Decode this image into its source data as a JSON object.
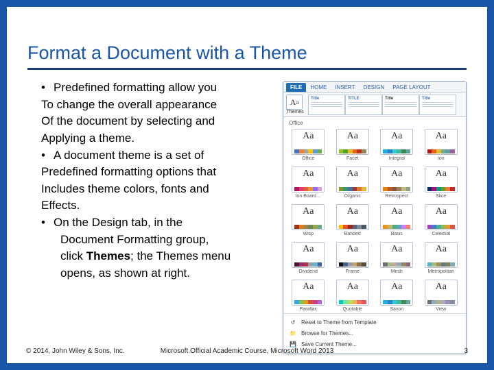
{
  "title": "Format a Document with a Theme",
  "bullets": {
    "l0": "Predefined formatting allow you",
    "l1": "To change the overall appearance",
    "l2": "Of the document by selecting and",
    "l3": "Applying a theme.",
    "l4": "A document theme is a set of",
    "l5": "Predefined formatting options that",
    "l6": "Includes theme colors, fonts and",
    "l7": "Effects.",
    "l8": "On the Design tab, in the",
    "l9": "Document Formatting group,",
    "l10a": "click ",
    "l10b": "Themes",
    "l10c": "; the Themes menu",
    "l11": "opens, as shown at right."
  },
  "ribbon": {
    "tabs": [
      "FILE",
      "HOME",
      "INSERT",
      "DESIGN",
      "PAGE LAYOUT"
    ],
    "themes_label": "Themes",
    "preview_title": "Title",
    "preview_title2": "TITLE",
    "preview_title3": "Title"
  },
  "sections": {
    "office": "Office"
  },
  "themes": [
    {
      "name": "Office",
      "colors": [
        "#4472c4",
        "#ed7d31",
        "#a5a5a5",
        "#ffc000",
        "#5b9bd5",
        "#70ad47"
      ]
    },
    {
      "name": "Facet",
      "colors": [
        "#90c226",
        "#54a021",
        "#e6b91e",
        "#e76618",
        "#c42f1a",
        "#918655"
      ]
    },
    {
      "name": "Integral",
      "colors": [
        "#1cade4",
        "#2683c6",
        "#27ced7",
        "#42ba97",
        "#3e8853",
        "#62a39f"
      ]
    },
    {
      "name": "Ion",
      "colors": [
        "#b01513",
        "#ea6312",
        "#e6b729",
        "#6aac90",
        "#5f9c9d",
        "#9e5e9b"
      ]
    },
    {
      "name": "Ion Board…",
      "colors": [
        "#b31166",
        "#e33d6f",
        "#e45f3c",
        "#e9943a",
        "#9b6bf2",
        "#d5a4cf"
      ]
    },
    {
      "name": "Organic",
      "colors": [
        "#83992a",
        "#3c9770",
        "#44709d",
        "#a23c33",
        "#d97828",
        "#deb340"
      ]
    },
    {
      "name": "Retrospect",
      "colors": [
        "#e48312",
        "#bd582c",
        "#865640",
        "#9b8357",
        "#c2bc80",
        "#94a088"
      ]
    },
    {
      "name": "Slice",
      "colors": [
        "#052f61",
        "#a50e82",
        "#14967c",
        "#6a9e1f",
        "#e87d37",
        "#c62324"
      ]
    },
    {
      "name": "Wisp",
      "colors": [
        "#a53010",
        "#de7e18",
        "#9f8351",
        "#728653",
        "#92aa4c",
        "#6aac91"
      ]
    },
    {
      "name": "Banded",
      "colors": [
        "#ffc000",
        "#f04e23",
        "#9b2d1f",
        "#5a6378",
        "#7b8b9b",
        "#4b5a6b"
      ]
    },
    {
      "name": "Basis",
      "colors": [
        "#f09415",
        "#c1b56b",
        "#4baf73",
        "#5aa6c0",
        "#d17df9",
        "#fa7e5c"
      ]
    },
    {
      "name": "Celestial",
      "colors": [
        "#ac3ec1",
        "#477bd1",
        "#46b298",
        "#90ba4c",
        "#dd9d31",
        "#e25247"
      ]
    },
    {
      "name": "Dividend",
      "colors": [
        "#4d1434",
        "#903163",
        "#b2324b",
        "#969fa7",
        "#66b1ce",
        "#40619d"
      ]
    },
    {
      "name": "Frame",
      "colors": [
        "#131313",
        "#40618a",
        "#989aac",
        "#c2a06a",
        "#8a6f4c",
        "#5b4f3a"
      ]
    },
    {
      "name": "Mesh",
      "colors": [
        "#6f6f74",
        "#a7b789",
        "#beae98",
        "#92a9b9",
        "#9c8265",
        "#8d6974"
      ]
    },
    {
      "name": "Metropolitan",
      "colors": [
        "#50b4c8",
        "#a8b97f",
        "#9b9256",
        "#657689",
        "#7a855d",
        "#84acb6"
      ]
    },
    {
      "name": "Parallax",
      "colors": [
        "#30acec",
        "#80c34f",
        "#e29d09",
        "#d64a3b",
        "#d13c78",
        "#a666e1"
      ]
    },
    {
      "name": "Quotable",
      "colors": [
        "#00c6bb",
        "#6feba0",
        "#b6df5e",
        "#efb251",
        "#ef755f",
        "#ed515c"
      ]
    },
    {
      "name": "Savon",
      "colors": [
        "#1cade4",
        "#2683c6",
        "#27ced7",
        "#42ba97",
        "#3e8853",
        "#62a39f"
      ]
    },
    {
      "name": "View",
      "colors": [
        "#6f6f74",
        "#92a9b9",
        "#a7b789",
        "#b0a6c2",
        "#9a8eb8",
        "#868ea3"
      ]
    }
  ],
  "panel_footer": {
    "reset": "Reset to Theme from Template",
    "browse": "Browse for Themes...",
    "save": "Save Current Theme..."
  },
  "footer": {
    "copyright": "© 2014, John Wiley & Sons, Inc.",
    "course": "Microsoft Official Academic Course, Microsoft Word 2013",
    "page": "3"
  }
}
